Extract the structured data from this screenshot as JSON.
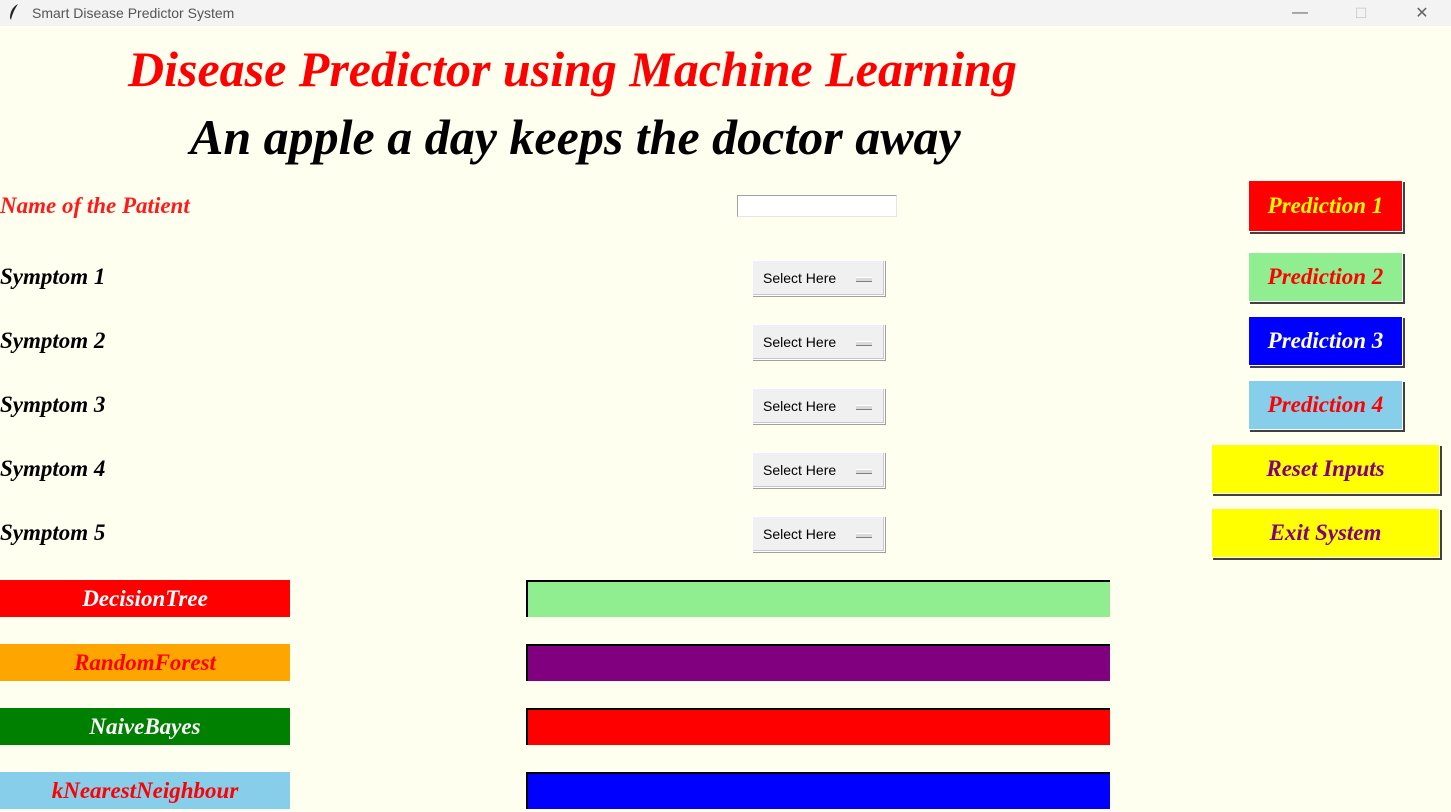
{
  "window": {
    "title": "Smart Disease Predictor System",
    "icon": "feather-icon",
    "minimize": "—",
    "maximize": "☐",
    "close": "✕"
  },
  "header": {
    "title": "Disease Predictor using Machine Learning",
    "subtitle": "An apple a day keeps the doctor away"
  },
  "form": {
    "patient_label": "Name of the Patient",
    "patient_value": "",
    "symptoms": [
      {
        "label": "Symptom 1",
        "value": "Select Here"
      },
      {
        "label": "Symptom 2",
        "value": "Select Here"
      },
      {
        "label": "Symptom 3",
        "value": "Select Here"
      },
      {
        "label": "Symptom 4",
        "value": "Select Here"
      },
      {
        "label": "Symptom 5",
        "value": "Select Here"
      }
    ]
  },
  "buttons": {
    "prediction1": "Prediction 1",
    "prediction2": "Prediction 2",
    "prediction3": "Prediction 3",
    "prediction4": "Prediction 4",
    "reset": "Reset Inputs",
    "exit": "Exit System"
  },
  "algorithms": [
    {
      "label": "DecisionTree",
      "bg": "#ff0000",
      "fg": "#ffffff",
      "result_color": "#90ee90",
      "result": ""
    },
    {
      "label": "RandomForest",
      "bg": "#ffa500",
      "fg": "#ff0000",
      "result_color": "#800080",
      "result": ""
    },
    {
      "label": "NaiveBayes",
      "bg": "#008000",
      "fg": "#ffffff",
      "result_color": "#ff0000",
      "result": ""
    },
    {
      "label": "kNearestNeighbour",
      "bg": "#87ceeb",
      "fg": "#ff0000",
      "result_color": "#0000ff",
      "result": ""
    }
  ],
  "colors": {
    "background": "#fffff0",
    "title": "#ff0000"
  }
}
